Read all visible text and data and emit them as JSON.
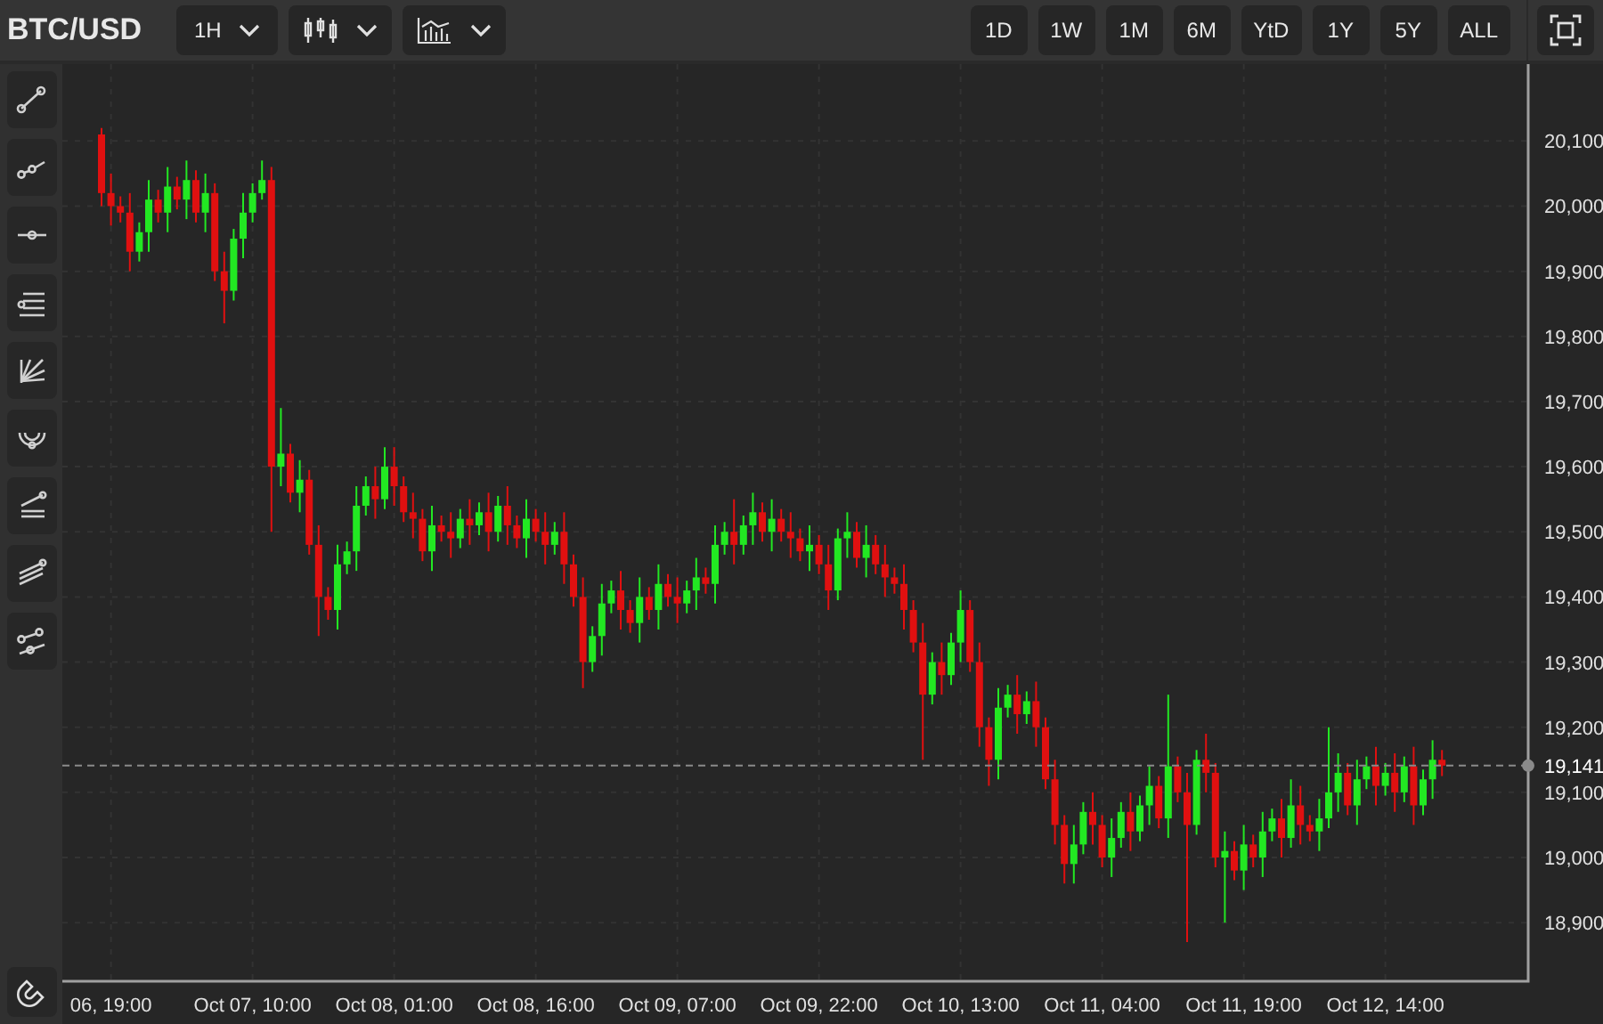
{
  "header": {
    "symbol": "BTC/USD",
    "interval": "1H",
    "ranges": [
      "1D",
      "1W",
      "1M",
      "6M",
      "YtD",
      "1Y",
      "5Y",
      "ALL"
    ]
  },
  "chart": {
    "chart_data": {
      "type": "candlestick",
      "categories": [
        null,
        "06, 19:00",
        null,
        null,
        null,
        null,
        null,
        null,
        null,
        null,
        null,
        null,
        null,
        null,
        null,
        null,
        "Oct 07, 10:00",
        null,
        null,
        null,
        null,
        null,
        null,
        null,
        null,
        null,
        null,
        null,
        null,
        null,
        null,
        "Oct 08, 01:00",
        null,
        null,
        null,
        null,
        null,
        null,
        null,
        null,
        null,
        null,
        null,
        null,
        null,
        null,
        "Oct 08, 16:00",
        null,
        null,
        null,
        null,
        null,
        null,
        null,
        null,
        null,
        null,
        null,
        null,
        null,
        null,
        "Oct 09, 07:00",
        null,
        null,
        null,
        null,
        null,
        null,
        null,
        null,
        null,
        null,
        null,
        null,
        null,
        null,
        "Oct 09, 22:00",
        null,
        null,
        null,
        null,
        null,
        null,
        null,
        null,
        null,
        null,
        null,
        null,
        null,
        null,
        "Oct 10, 13:00",
        null,
        null,
        null,
        null,
        null,
        null,
        null,
        null,
        null,
        null,
        null,
        null,
        null,
        null,
        "Oct 11, 04:00",
        null,
        null,
        null,
        null,
        null,
        null,
        null,
        null,
        null,
        null,
        null,
        null,
        null,
        null,
        "Oct 11, 19:00",
        null,
        null,
        null,
        null,
        null,
        null,
        null,
        null,
        null,
        null,
        null,
        null,
        null,
        null,
        "Oct 12, 14:00",
        null,
        null,
        null,
        null,
        null,
        null
      ],
      "ylim": [
        18810,
        20218
      ],
      "grid": true,
      "ref_lines": [
        {
          "axis": "y",
          "value": 19141,
          "label": "19,141"
        }
      ],
      "ohlc": [
        [
          20110,
          20120,
          20000,
          20020
        ],
        [
          20020,
          20050,
          19970,
          20000
        ],
        [
          20000,
          20015,
          19975,
          19990
        ],
        [
          19990,
          20020,
          19900,
          19930
        ],
        [
          19930,
          19975,
          19915,
          19960
        ],
        [
          19960,
          20040,
          19930,
          20010
        ],
        [
          20010,
          20025,
          19975,
          19990
        ],
        [
          19990,
          20060,
          19960,
          20030
        ],
        [
          20030,
          20045,
          19995,
          20010
        ],
        [
          20010,
          20070,
          19980,
          20040
        ],
        [
          20040,
          20055,
          19975,
          19990
        ],
        [
          19990,
          20050,
          19960,
          20020
        ],
        [
          20020,
          20035,
          19885,
          19900
        ],
        [
          19900,
          19930,
          19820,
          19870
        ],
        [
          19870,
          19965,
          19855,
          19950
        ],
        [
          19950,
          20020,
          19920,
          19990
        ],
        [
          19990,
          20035,
          19975,
          20020
        ],
        [
          20020,
          20070,
          20010,
          20040
        ],
        [
          20040,
          20060,
          19500,
          19600
        ],
        [
          19600,
          19690,
          19570,
          19620
        ],
        [
          19620,
          19635,
          19545,
          19560
        ],
        [
          19560,
          19610,
          19530,
          19580
        ],
        [
          19580,
          19595,
          19465,
          19480
        ],
        [
          19480,
          19510,
          19340,
          19400
        ],
        [
          19400,
          19415,
          19365,
          19380
        ],
        [
          19380,
          19480,
          19350,
          19450
        ],
        [
          19450,
          19485,
          19435,
          19470
        ],
        [
          19470,
          19570,
          19440,
          19540
        ],
        [
          19540,
          19585,
          19525,
          19570
        ],
        [
          19570,
          19600,
          19520,
          19550
        ],
        [
          19550,
          19630,
          19535,
          19600
        ],
        [
          19600,
          19630,
          19540,
          19570
        ],
        [
          19570,
          19585,
          19515,
          19530
        ],
        [
          19530,
          19560,
          19490,
          19520
        ],
        [
          19520,
          19535,
          19455,
          19470
        ],
        [
          19470,
          19540,
          19440,
          19510
        ],
        [
          19510,
          19525,
          19485,
          19500
        ],
        [
          19500,
          19530,
          19460,
          19490
        ],
        [
          19490,
          19535,
          19475,
          19520
        ],
        [
          19520,
          19550,
          19480,
          19510
        ],
        [
          19510,
          19545,
          19495,
          19530
        ],
        [
          19530,
          19560,
          19470,
          19500
        ],
        [
          19500,
          19555,
          19485,
          19540
        ],
        [
          19540,
          19570,
          19480,
          19510
        ],
        [
          19510,
          19525,
          19475,
          19490
        ],
        [
          19490,
          19550,
          19460,
          19520
        ],
        [
          19520,
          19535,
          19485,
          19500
        ],
        [
          19500,
          19530,
          19450,
          19480
        ],
        [
          19480,
          19515,
          19465,
          19500
        ],
        [
          19500,
          19530,
          19420,
          19450
        ],
        [
          19450,
          19465,
          19385,
          19400
        ],
        [
          19400,
          19430,
          19260,
          19300
        ],
        [
          19300,
          19355,
          19285,
          19340
        ],
        [
          19340,
          19420,
          19310,
          19390
        ],
        [
          19390,
          19425,
          19375,
          19410
        ],
        [
          19410,
          19440,
          19350,
          19380
        ],
        [
          19380,
          19395,
          19345,
          19360
        ],
        [
          19360,
          19430,
          19330,
          19400
        ],
        [
          19400,
          19415,
          19365,
          19380
        ],
        [
          19380,
          19450,
          19350,
          19420
        ],
        [
          19420,
          19435,
          19385,
          19400
        ],
        [
          19400,
          19430,
          19360,
          19390
        ],
        [
          19390,
          19425,
          19375,
          19410
        ],
        [
          19410,
          19460,
          19380,
          19430
        ],
        [
          19430,
          19445,
          19405,
          19420
        ],
        [
          19420,
          19510,
          19390,
          19480
        ],
        [
          19480,
          19515,
          19465,
          19500
        ],
        [
          19500,
          19550,
          19450,
          19480
        ],
        [
          19480,
          19525,
          19465,
          19510
        ],
        [
          19510,
          19560,
          19480,
          19530
        ],
        [
          19530,
          19545,
          19485,
          19500
        ],
        [
          19500,
          19550,
          19470,
          19520
        ],
        [
          19520,
          19535,
          19485,
          19500
        ],
        [
          19500,
          19530,
          19460,
          19490
        ],
        [
          19490,
          19505,
          19455,
          19470
        ],
        [
          19470,
          19510,
          19440,
          19480
        ],
        [
          19480,
          19495,
          19435,
          19450
        ],
        [
          19450,
          19480,
          19380,
          19410
        ],
        [
          19410,
          19505,
          19395,
          19490
        ],
        [
          19490,
          19530,
          19460,
          19500
        ],
        [
          19500,
          19515,
          19445,
          19460
        ],
        [
          19460,
          19510,
          19430,
          19480
        ],
        [
          19480,
          19495,
          19435,
          19450
        ],
        [
          19450,
          19480,
          19400,
          19430
        ],
        [
          19430,
          19445,
          19405,
          19420
        ],
        [
          19420,
          19450,
          19350,
          19380
        ],
        [
          19380,
          19395,
          19315,
          19330
        ],
        [
          19330,
          19360,
          19150,
          19250
        ],
        [
          19250,
          19315,
          19235,
          19300
        ],
        [
          19300,
          19330,
          19250,
          19280
        ],
        [
          19280,
          19345,
          19265,
          19330
        ],
        [
          19330,
          19410,
          19300,
          19380
        ],
        [
          19380,
          19395,
          19285,
          19300
        ],
        [
          19300,
          19330,
          19170,
          19200
        ],
        [
          19200,
          19215,
          19110,
          19150
        ],
        [
          19150,
          19260,
          19120,
          19230
        ],
        [
          19230,
          19265,
          19215,
          19250
        ],
        [
          19250,
          19280,
          19190,
          19220
        ],
        [
          19220,
          19255,
          19205,
          19240
        ],
        [
          19240,
          19270,
          19170,
          19200
        ],
        [
          19200,
          19215,
          19105,
          19120
        ],
        [
          19120,
          19150,
          19020,
          19050
        ],
        [
          19050,
          19065,
          18960,
          18990
        ],
        [
          18990,
          19050,
          18960,
          19020
        ],
        [
          19020,
          19085,
          19005,
          19070
        ],
        [
          19070,
          19100,
          19020,
          19050
        ],
        [
          19050,
          19065,
          18985,
          19000
        ],
        [
          19000,
          19060,
          18970,
          19030
        ],
        [
          19030,
          19085,
          19015,
          19070
        ],
        [
          19070,
          19100,
          19010,
          19040
        ],
        [
          19040,
          19095,
          19025,
          19080
        ],
        [
          19080,
          19140,
          19050,
          19110
        ],
        [
          19110,
          19125,
          19045,
          19060
        ],
        [
          19060,
          19250,
          19030,
          19140
        ],
        [
          19140,
          19155,
          19085,
          19100
        ],
        [
          19100,
          19130,
          18870,
          19050
        ],
        [
          19050,
          19165,
          19035,
          19150
        ],
        [
          19150,
          19190,
          19100,
          19130
        ],
        [
          19130,
          19145,
          18985,
          19000
        ],
        [
          19000,
          19040,
          18900,
          19010
        ],
        [
          19010,
          19025,
          18965,
          18980
        ],
        [
          18980,
          19050,
          18950,
          19020
        ],
        [
          19020,
          19035,
          18985,
          19000
        ],
        [
          19000,
          19070,
          18970,
          19040
        ],
        [
          19040,
          19075,
          19025,
          19060
        ],
        [
          19060,
          19090,
          19000,
          19030
        ],
        [
          19030,
          19120,
          19015,
          19080
        ],
        [
          19080,
          19110,
          19020,
          19050
        ],
        [
          19050,
          19065,
          19025,
          19040
        ],
        [
          19040,
          19090,
          19010,
          19060
        ],
        [
          19060,
          19200,
          19045,
          19100
        ],
        [
          19100,
          19160,
          19070,
          19130
        ],
        [
          19130,
          19145,
          19065,
          19080
        ],
        [
          19080,
          19150,
          19050,
          19120
        ],
        [
          19120,
          19155,
          19105,
          19140
        ],
        [
          19140,
          19170,
          19080,
          19110
        ],
        [
          19110,
          19145,
          19095,
          19130
        ],
        [
          19130,
          19160,
          19070,
          19100
        ],
        [
          19100,
          19155,
          19085,
          19140
        ],
        [
          19140,
          19170,
          19050,
          19080
        ],
        [
          19080,
          19135,
          19065,
          19120
        ],
        [
          19120,
          19180,
          19090,
          19150
        ],
        [
          19150,
          19165,
          19125,
          19141
        ]
      ],
      "yticks": [
        {
          "value": 20100,
          "label": "20,100"
        },
        {
          "value": 20000,
          "label": "20,000"
        },
        {
          "value": 19900,
          "label": "19,900"
        },
        {
          "value": 19800,
          "label": "19,800"
        },
        {
          "value": 19700,
          "label": "19,700"
        },
        {
          "value": 19600,
          "label": "19,600"
        },
        {
          "value": 19500,
          "label": "19,500"
        },
        {
          "value": 19400,
          "label": "19,400"
        },
        {
          "value": 19300,
          "label": "19,300"
        },
        {
          "value": 19200,
          "label": "19,200"
        },
        {
          "value": 19100,
          "label": "19,100"
        },
        {
          "value": 19000,
          "label": "19,000"
        },
        {
          "value": 18900,
          "label": "18,900"
        }
      ]
    }
  }
}
